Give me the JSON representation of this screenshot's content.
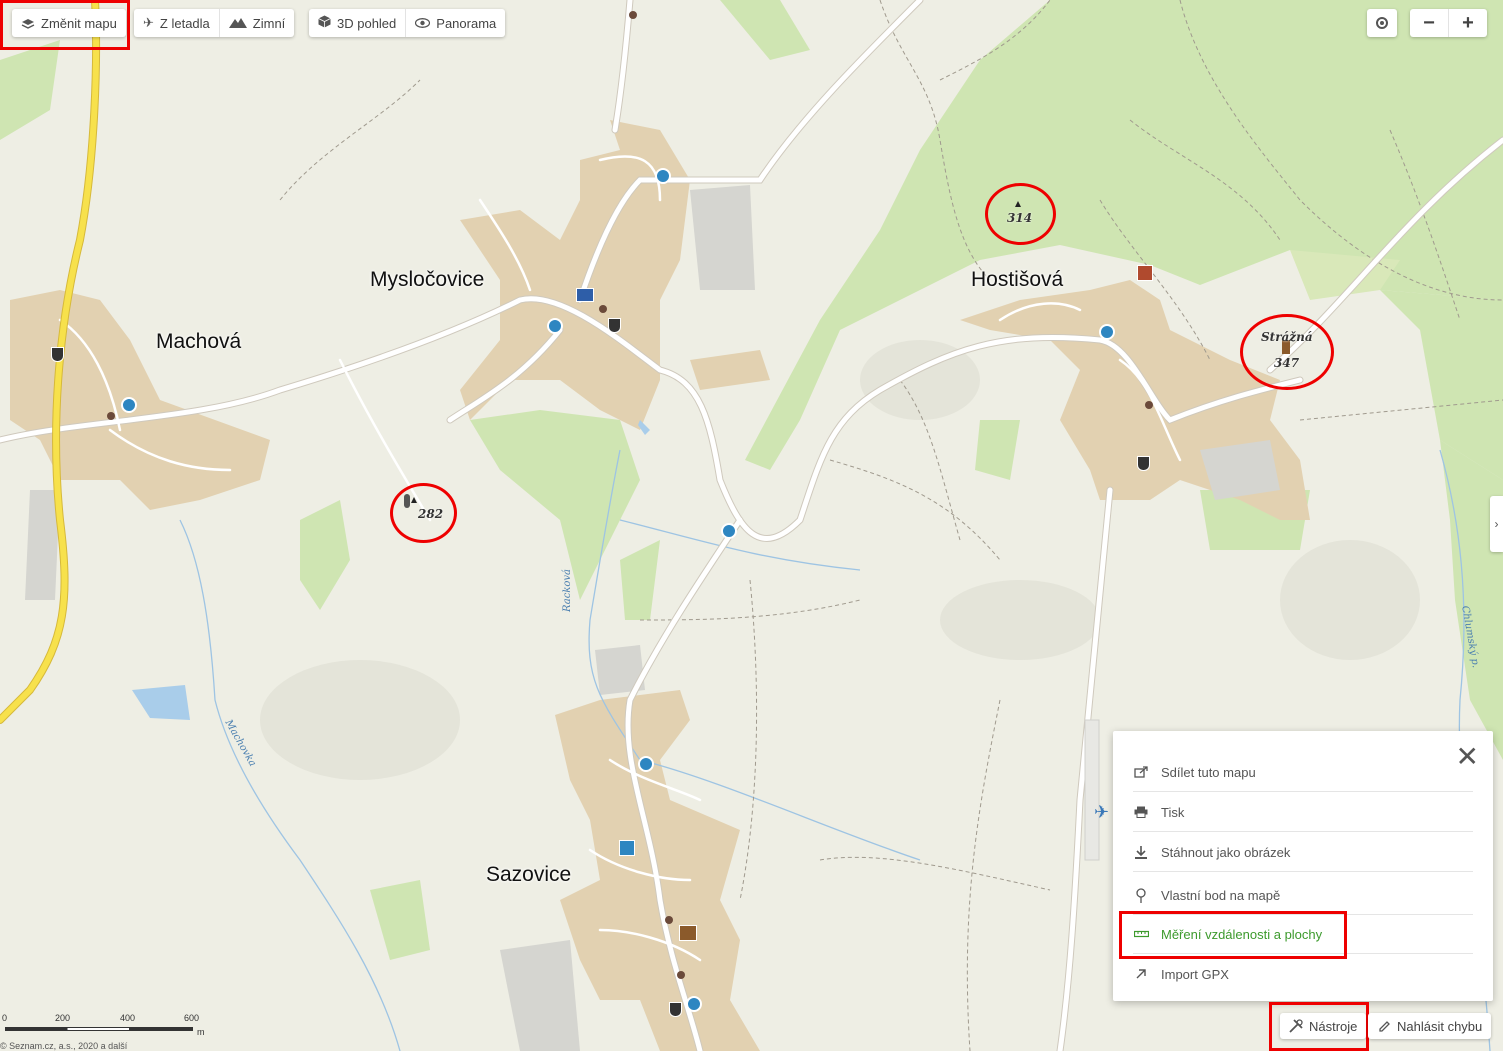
{
  "toolbar": {
    "change_map": "Změnit mapu",
    "aerial": "Z letadla",
    "winter": "Zimní",
    "view3d": "3D pohled",
    "panorama": "Panorama"
  },
  "zoom": {
    "minus": "−",
    "plus": "+"
  },
  "places": {
    "machova": "Machová",
    "myslocovice": "Mysločovice",
    "hostisova": "Hostišová",
    "sazovice": "Sazovice"
  },
  "peaks": {
    "p314": "314",
    "p282": "282",
    "straznа_name": "Strážná",
    "p347": "347"
  },
  "streams": {
    "rackova": "Racková",
    "machovka": "Machovka",
    "chlumsky": "Chlumský p."
  },
  "tools_panel": {
    "close": "✕",
    "items": [
      {
        "label": "Sdílet tuto mapu",
        "icon": "share-icon"
      },
      {
        "label": "Tisk",
        "icon": "print-icon"
      },
      {
        "label": "Stáhnout jako obrázek",
        "icon": "download-icon"
      },
      {
        "label": "Vlastní bod na mapě",
        "icon": "pin-icon"
      },
      {
        "label": "Měření vzdálenosti a plochy",
        "icon": "ruler-icon"
      },
      {
        "label": "Import GPX",
        "icon": "import-arrow-icon"
      }
    ]
  },
  "bottom": {
    "tools": "Nástroje",
    "report": "Nahlásit chybu"
  },
  "scale": {
    "t0": "0",
    "t200": "200",
    "t400": "400",
    "t600": "600",
    "unit": "m"
  },
  "copyright": "© Seznam.cz, a.s., 2020 a další",
  "colors": {
    "highlight": "#e00000",
    "active_tool": "#3c9a2c",
    "urban": "#e2d1b1",
    "forest": "#c6e0a8",
    "road": "#ffffff",
    "major_road": "#f7e14c",
    "water": "#a9cdea"
  }
}
